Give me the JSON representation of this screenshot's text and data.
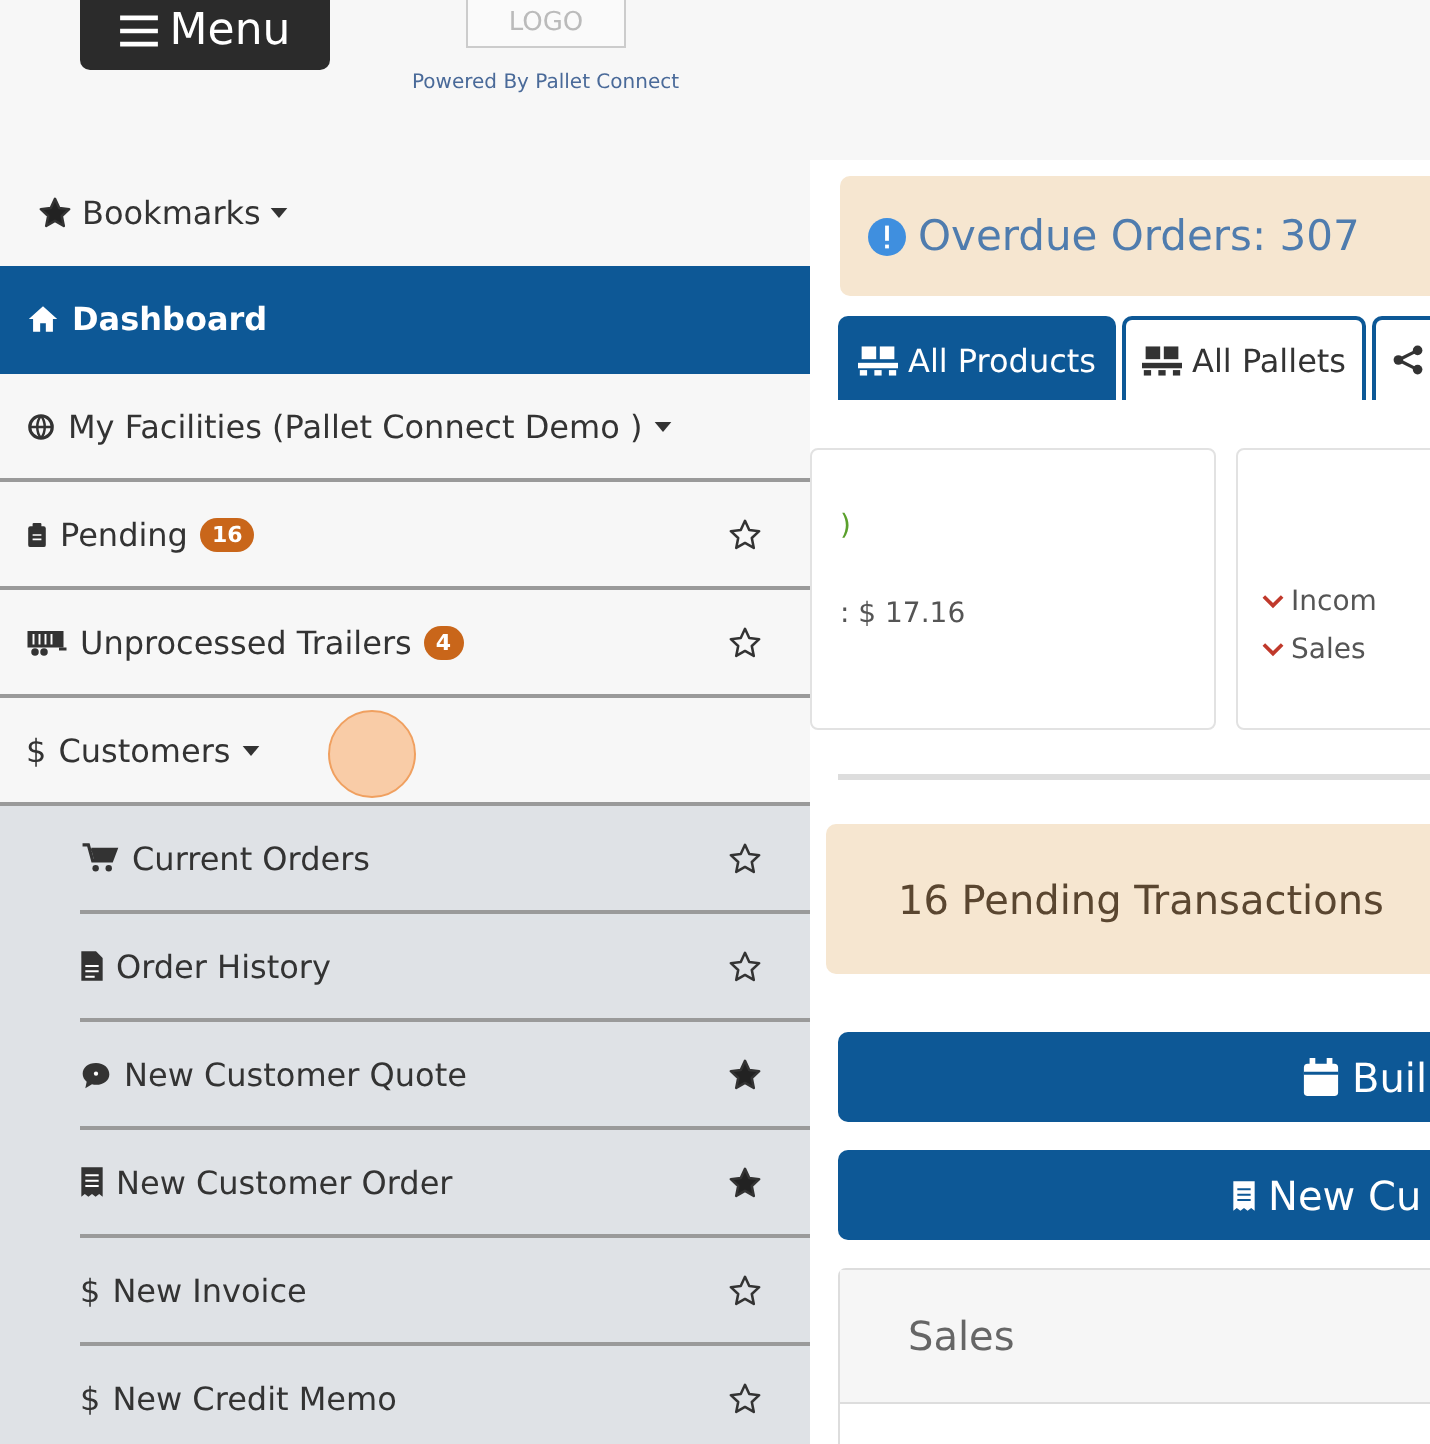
{
  "header": {
    "menu_button": "Menu",
    "logo": "LOGO",
    "powered_by": "Powered By Pallet Connect"
  },
  "sidebar": {
    "bookmarks": "Bookmarks",
    "items": [
      {
        "kind": "link",
        "label": "Dashboard",
        "selected": true
      },
      {
        "kind": "dropdown",
        "label": "My Facilities (Pallet Connect Demo )",
        "selected": false
      },
      {
        "kind": "bookmarkable",
        "label": "Pending",
        "badge": "16",
        "bookmarked": false,
        "selected": false
      },
      {
        "kind": "bookmarkable",
        "label": "Unprocessed Trailers",
        "badge": "4",
        "bookmarked": false,
        "selected": false
      },
      {
        "kind": "dropdown",
        "icon": "$",
        "label": "Customers",
        "selected": false,
        "expanded": true,
        "children": [
          {
            "label": "Current Orders",
            "bookmarked": false
          },
          {
            "label": "Order History",
            "bookmarked": false
          },
          {
            "label": "New Customer Quote",
            "bookmarked": true
          },
          {
            "label": "New Customer Order",
            "bookmarked": true
          },
          {
            "icon": "$",
            "label": "New Invoice",
            "bookmarked": false
          },
          {
            "icon": "$",
            "label": "New Credit Memo",
            "bookmarked": false
          }
        ]
      }
    ]
  },
  "content": {
    "alert": "Overdue Orders: 307",
    "tabs": [
      {
        "label": "All Products",
        "selected": true
      },
      {
        "label": "All Pallets",
        "selected": false
      },
      {
        "selected": false
      }
    ],
    "card_1": {
      "status": ")",
      "detail": ": $ 17.16"
    },
    "card_2": {
      "rows": [
        "Incom",
        "Sales"
      ]
    },
    "pending": "16 Pending Transactions",
    "buttons": [
      "Buil",
      "New Cu"
    ],
    "panel_title": "Sales"
  }
}
